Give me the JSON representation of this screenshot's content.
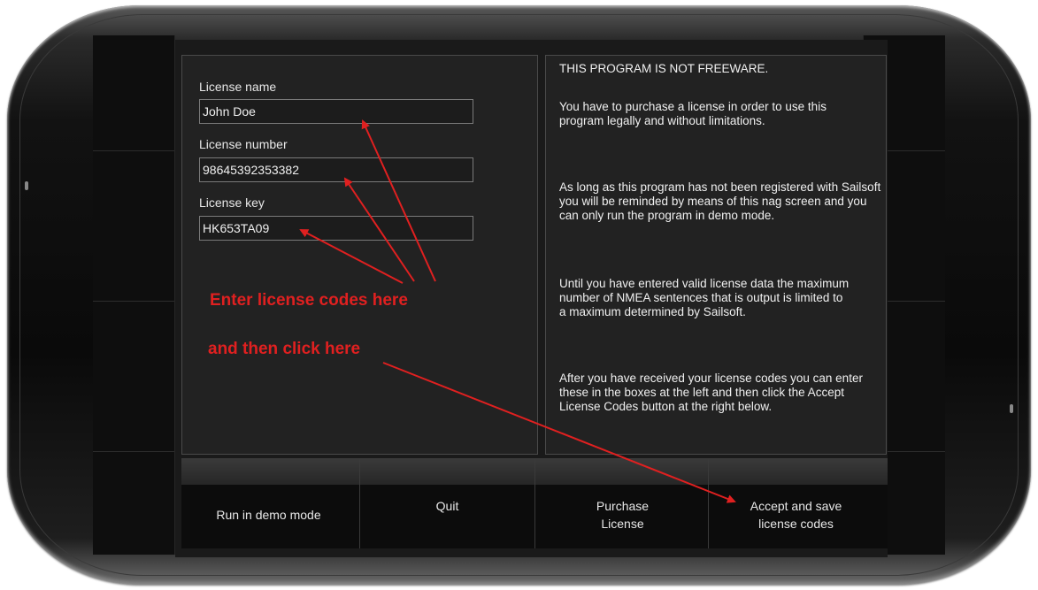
{
  "form": {
    "license_name_label": "License name",
    "license_name_value": "John Doe",
    "license_number_label": "License number",
    "license_number_value": "98645392353382",
    "license_key_label": "License key",
    "license_key_value": "HK653TA09"
  },
  "annotations": {
    "enter_codes": "Enter license codes here",
    "click_here": "and then click here"
  },
  "info": {
    "title": "THIS PROGRAM IS NOT FREEWARE.",
    "para1": "You have to purchase a license in order to use this program legally and without limitations.",
    "para2": "As long as this program has not been registered with Sailsoft you will be reminded by means of this nag screen and you can only run the program in demo mode.",
    "para3": "Until you have entered valid license data the maximum number of NMEA sentences that is output is limited to a maximum determined by Sailsoft.",
    "para4": "After you have received your license codes you can enter these in the boxes at the left and then click the Accept License Codes button at the right below."
  },
  "buttons": {
    "run_demo": "Run in demo mode",
    "quit": "Quit",
    "purchase": "Purchase License",
    "accept": "Accept and save license codes"
  },
  "colors": {
    "annotation": "#e02020",
    "background": "#1a1a1a"
  }
}
